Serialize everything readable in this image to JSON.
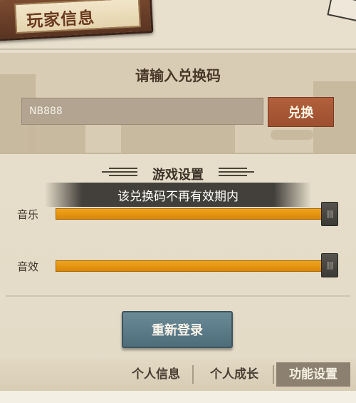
{
  "header": {
    "title": "玩家信息"
  },
  "redeem": {
    "title": "请输入兑换码",
    "code_value": "NB888",
    "button_label": "兑换"
  },
  "settings": {
    "title": "游戏设置",
    "toast": "该兑换码不再有效期内",
    "music": {
      "label": "音乐",
      "level_percent": 100
    },
    "sfx": {
      "label": "音效",
      "level_percent": 100
    },
    "handle_glyph": "|||"
  },
  "relogin_label": "重新登录",
  "tabs": [
    {
      "label": "个人信息",
      "active": false
    },
    {
      "label": "个人成长",
      "active": false
    },
    {
      "label": "功能设置",
      "active": true
    }
  ],
  "colors": {
    "accent_orange": "#e8960f",
    "redeem_button": "#a8583a",
    "relogin_button": "#5f7d8a"
  }
}
